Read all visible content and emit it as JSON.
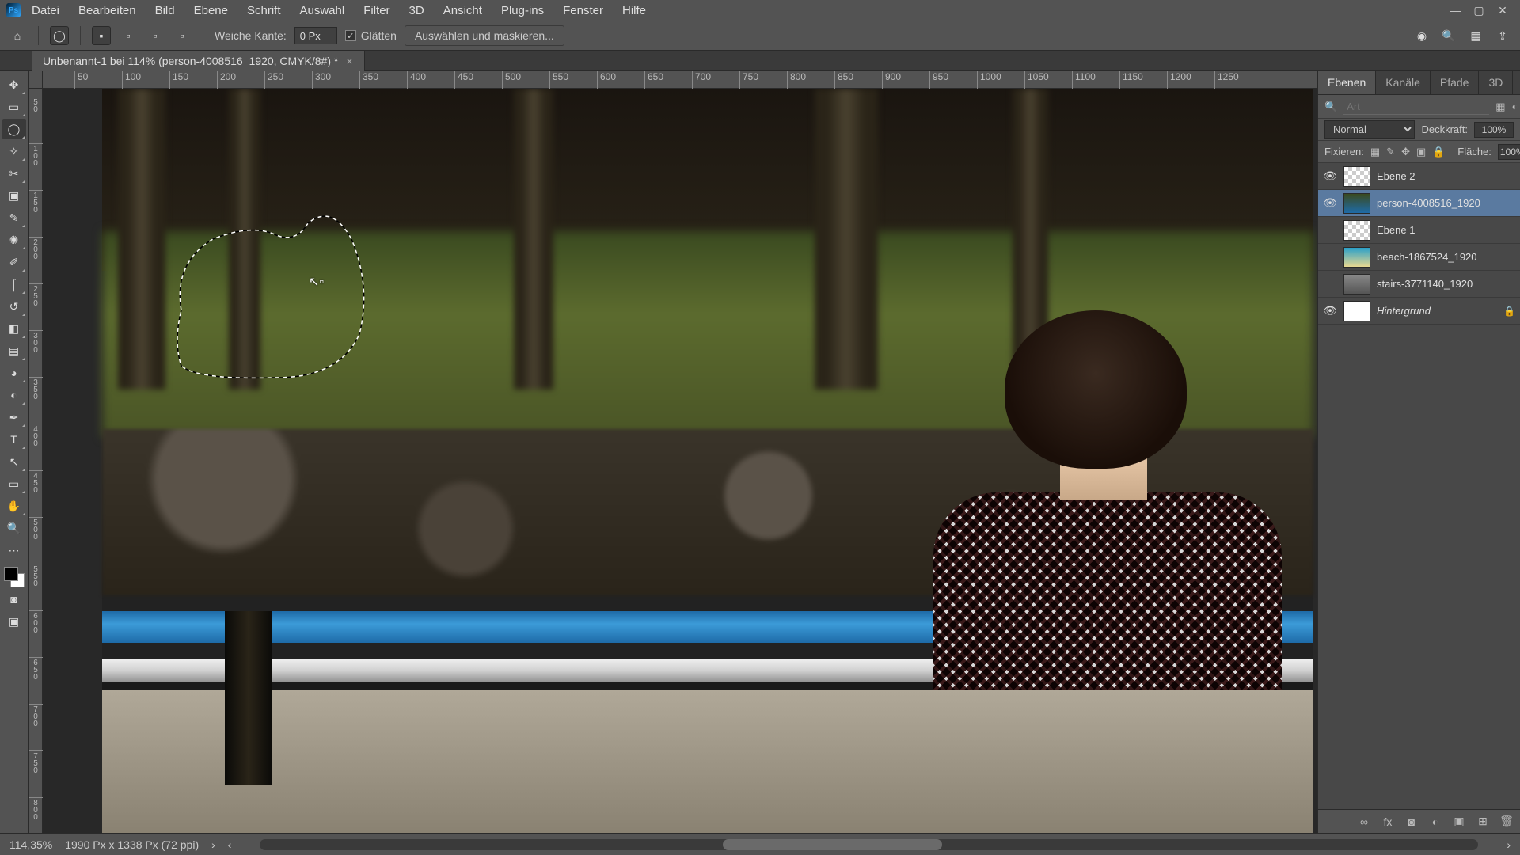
{
  "menubar": {
    "items": [
      "Datei",
      "Bearbeiten",
      "Bild",
      "Ebene",
      "Schrift",
      "Auswahl",
      "Filter",
      "3D",
      "Ansicht",
      "Plug-ins",
      "Fenster",
      "Hilfe"
    ]
  },
  "optionsbar": {
    "feather_label": "Weiche Kante:",
    "feather_value": "0 Px",
    "antialias_label": "Glätten",
    "select_mask_label": "Auswählen und maskieren..."
  },
  "doctab": {
    "title": "Unbenannt-1 bei 114% (person-4008516_1920, CMYK/8#) *"
  },
  "ruler_h": [
    "50",
    "100",
    "150",
    "200",
    "250",
    "300",
    "350",
    "400",
    "450",
    "500",
    "550",
    "600",
    "650",
    "700",
    "750",
    "800",
    "850",
    "900",
    "950",
    "1000",
    "1050",
    "1100",
    "1150",
    "1200",
    "1250"
  ],
  "ruler_v": [
    "5 0",
    "1 0 0",
    "1 5 0",
    "2 0 0",
    "2 5 0",
    "3 0 0",
    "3 5 0",
    "4 0 0",
    "4 5 0",
    "5 0 0",
    "5 5 0",
    "6 0 0",
    "6 5 0",
    "7 0 0",
    "7 5 0",
    "8 0 0"
  ],
  "panels": {
    "tabs": [
      "Ebenen",
      "Kanäle",
      "Pfade",
      "3D"
    ],
    "search_placeholder": "Art",
    "blend_mode": "Normal",
    "opacity_label": "Deckkraft:",
    "opacity_value": "100%",
    "lock_label": "Fixieren:",
    "fill_label": "Fläche:",
    "fill_value": "100%"
  },
  "layers": [
    {
      "visible": true,
      "thumb": "checker",
      "name": "Ebene 2",
      "selected": false,
      "italic": false,
      "locked": false
    },
    {
      "visible": true,
      "thumb": "img",
      "name": "person-4008516_1920",
      "selected": true,
      "italic": false,
      "locked": false
    },
    {
      "visible": false,
      "thumb": "checker",
      "name": "Ebene 1",
      "selected": false,
      "italic": false,
      "locked": false
    },
    {
      "visible": false,
      "thumb": "img2",
      "name": "beach-1867524_1920",
      "selected": false,
      "italic": false,
      "locked": false
    },
    {
      "visible": false,
      "thumb": "img3",
      "name": "stairs-3771140_1920",
      "selected": false,
      "italic": false,
      "locked": false
    },
    {
      "visible": true,
      "thumb": "white",
      "name": "Hintergrund",
      "selected": false,
      "italic": true,
      "locked": true
    }
  ],
  "statusbar": {
    "zoom": "114,35%",
    "docinfo": "1990 Px x 1338 Px (72 ppi)"
  }
}
